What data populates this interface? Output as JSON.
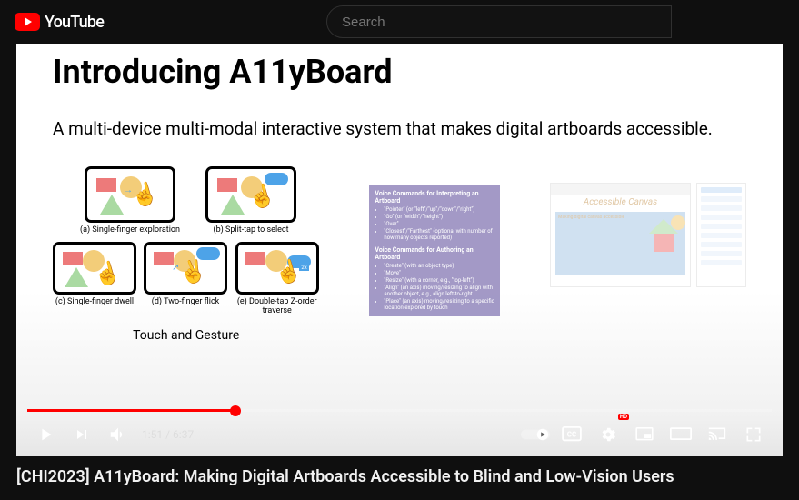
{
  "header": {
    "logo_text": "YouTube",
    "search_placeholder": "Search"
  },
  "slide": {
    "title": "Introducing A11yBoard",
    "subtitle": "A multi-device multi-modal interactive system that makes digital artboards accessible.",
    "gestures": {
      "a": "(a) Single-finger exploration",
      "b": "(b) Split-tap to select",
      "c": "(c) Single-finger dwell",
      "d": "(d) Two-finger flick",
      "e": "(e) Double-tap Z-order traverse"
    },
    "touch_label": "Touch and Gesture",
    "voice_panel": {
      "heading1": "Voice Commands for Interpreting an Artboard",
      "items1": [
        "\"Pointer\" (or \"left\"/\"up\"/\"down\"/\"right\")",
        "\"Go\" (or \"width\"/\"height\")",
        "\"Over\"",
        "\"Closest\"/\"Farthest\" (optional with number of how many objects reported)"
      ],
      "heading2": "Voice Commands for Authoring an Artboard",
      "items2": [
        "\"Create\" (with an object type)",
        "\"Move\"",
        "\"Resize\" (with a corner, e.g., \"top-left\")",
        "\"Align\" (an axis) moving/resizing to align with another object, e.g., align left-to-right",
        "\"Place\" (an axis) moving/resizing to a specific location explored by touch"
      ]
    },
    "canvas_title": "Accessible Canvas",
    "canvas_text": "Making digital canvas accessible"
  },
  "player": {
    "current_time": "1:51",
    "duration": "6:37",
    "progress_pct": 27.9,
    "hd": "HD"
  },
  "video_title": "[CHI2023] A11yBoard: Making Digital Artboards Accessible to Blind and Low-Vision Users"
}
